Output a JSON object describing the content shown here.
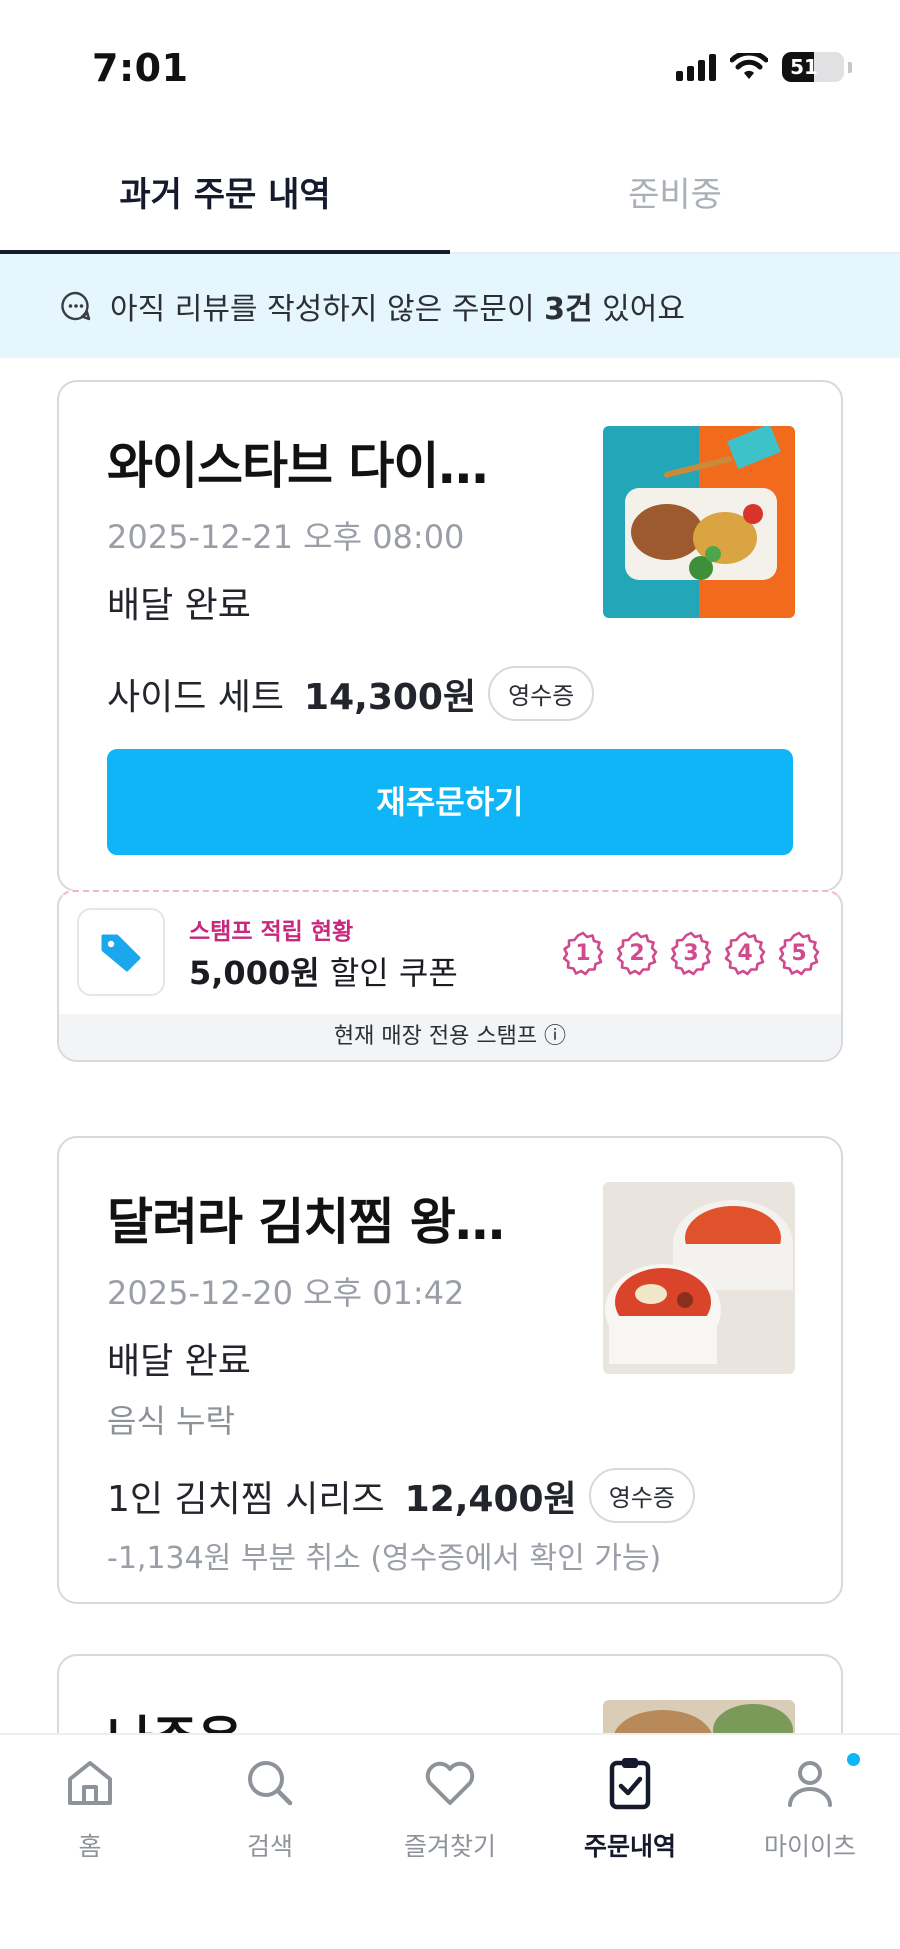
{
  "status_bar": {
    "time": "7:01",
    "battery": "51",
    "battery_level": 0.51
  },
  "tabs": [
    {
      "label": "과거 주문 내역",
      "active": true
    },
    {
      "label": "준비중",
      "active": false
    }
  ],
  "review_banner": {
    "prefix": "아직 리뷰를 작성하지 않은 주문이 ",
    "count": "3건",
    "suffix": " 있어요"
  },
  "orders": [
    {
      "store": "와이스타브 다이…",
      "date": "2025-12-21 오후 08:00",
      "status": "배달 완료",
      "item": "사이드 세트",
      "price": "14,300원",
      "receipt_label": "영수증",
      "reorder_label": "재주문하기"
    },
    {
      "store": "달려라 김치찜 왕…",
      "date": "2025-12-20 오후 01:42",
      "status": "배달 완료",
      "sub_status": "음식 누락",
      "item": "1인 김치찜 시리즈",
      "price": "12,400원",
      "receipt_label": "영수증",
      "refund_note": "-1,134원 부분 취소 (영수증에서 확인 가능)"
    },
    {
      "store": "나주옥"
    }
  ],
  "stamp": {
    "title": "스탬프 적립 현황",
    "coupon_amount": "5,000원",
    "coupon_text": " 할인 쿠폰",
    "stamps": [
      "1",
      "2",
      "3",
      "4",
      "5"
    ],
    "footer": "현재 매장 전용 스탬프 ⓘ",
    "accent_color": "#c7297e"
  },
  "bottom_nav": [
    {
      "label": "홈",
      "icon": "home-icon"
    },
    {
      "label": "검색",
      "icon": "search-icon"
    },
    {
      "label": "즐겨찾기",
      "icon": "heart-icon"
    },
    {
      "label": "주문내역",
      "icon": "order-history-icon",
      "active": true
    },
    {
      "label": "마이이츠",
      "icon": "profile-icon",
      "badge": true
    }
  ],
  "colors": {
    "accent": "#0fb5f7",
    "banner_bg": "#e6f6fd",
    "text_dark": "#161a2d",
    "muted": "#9a9ea6"
  }
}
